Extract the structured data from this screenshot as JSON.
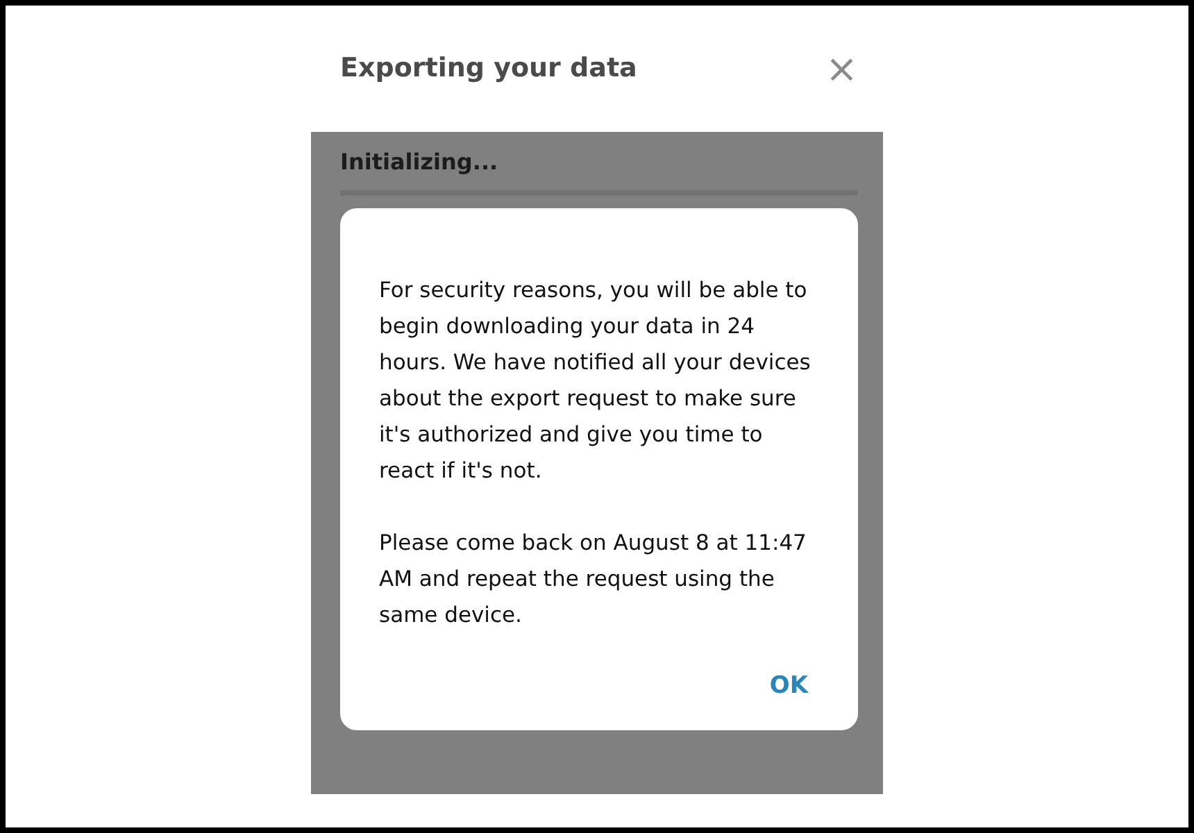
{
  "window": {
    "title": "Exporting your data",
    "close": "×"
  },
  "progress": {
    "status": "Initializing...",
    "level": 0
  },
  "alert": {
    "paragraphs": [
      "For security reasons, you will be able to begin downloading your data in 24 hours. We have notified all your devices about the export request to make sure it's authorized and give you time to react if it's not.",
      "Please come back on August 8 at 11:47 AM and repeat the request using the same device."
    ],
    "button": "OK"
  }
}
